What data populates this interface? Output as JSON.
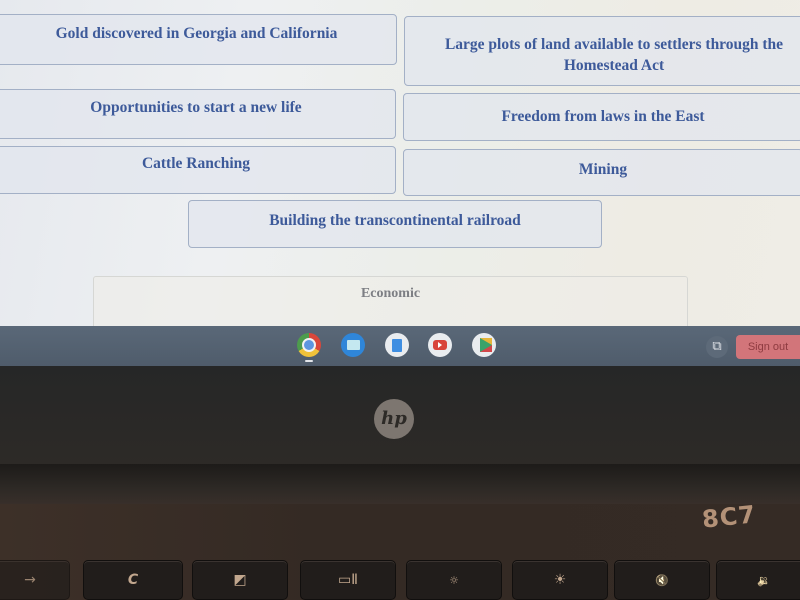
{
  "activity": {
    "answer_tiles": [
      {
        "label": "Gold discovered in Georgia and California"
      },
      {
        "label": "Large plots of land available to settlers through the Homestead Act"
      },
      {
        "label": "Opportunities to start a new life"
      },
      {
        "label": "Freedom from laws in the East"
      },
      {
        "label": "Cattle Ranching"
      },
      {
        "label": "Mining"
      },
      {
        "label": "Building the transcontinental railroad"
      }
    ],
    "drop_zone": {
      "label": "Economic"
    }
  },
  "shelf": {
    "apps": [
      {
        "name": "Chrome",
        "icon": "chrome-icon",
        "running": true
      },
      {
        "name": "Files",
        "icon": "folder-icon"
      },
      {
        "name": "Google Docs",
        "icon": "docs-icon"
      },
      {
        "name": "YouTube",
        "icon": "youtube-icon"
      },
      {
        "name": "Play Store",
        "icon": "play-store-icon"
      }
    ],
    "tray_icon": "⧉",
    "sign_out_label": "Sign out"
  },
  "laptop": {
    "logo": "hp",
    "sticker_text": "8C7",
    "keys": [
      {
        "name": "forward",
        "glyph": "→"
      },
      {
        "name": "refresh",
        "glyph": "C"
      },
      {
        "name": "fullscreen",
        "glyph": "◩"
      },
      {
        "name": "overview",
        "glyph": "▭Ⅱ"
      },
      {
        "name": "brightness-down",
        "glyph": "☼"
      },
      {
        "name": "brightness-up",
        "glyph": "☀"
      },
      {
        "name": "mute",
        "glyph": "🔇"
      },
      {
        "name": "volume-down",
        "glyph": "🔉"
      }
    ]
  }
}
